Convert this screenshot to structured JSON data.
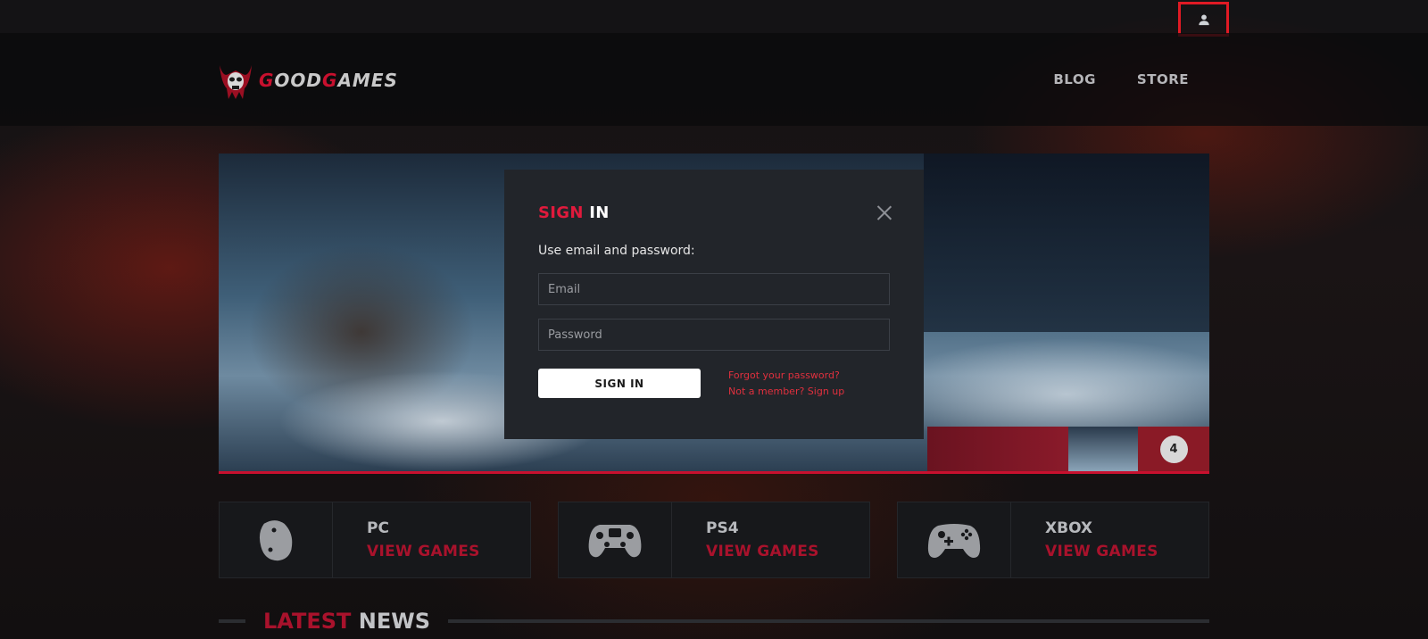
{
  "site": {
    "logo_part1": "G",
    "logo_part2": "OOD",
    "logo_part3": "G",
    "logo_part4": "AMES"
  },
  "topbar": {
    "user_icon": "user-icon"
  },
  "nav": {
    "items": [
      {
        "label": "BLOG"
      },
      {
        "label": "STORE"
      }
    ]
  },
  "slider": {
    "thumb_count": "4"
  },
  "modal": {
    "title_part1": "SIGN",
    "title_part2": "IN",
    "subtitle": "Use email and password:",
    "email_placeholder": "Email",
    "password_placeholder": "Password",
    "submit_label": "SIGN IN",
    "forgot_link": "Forgot your password?",
    "signup_link": "Not a member? Sign up",
    "close_icon": "close-icon"
  },
  "platforms": [
    {
      "name": "PC",
      "link": "VIEW GAMES",
      "icon": "mouse-icon"
    },
    {
      "name": "PS4",
      "link": "VIEW GAMES",
      "icon": "gamepad-icon"
    },
    {
      "name": "XBOX",
      "link": "VIEW GAMES",
      "icon": "xbox-controller-icon"
    }
  ],
  "news": {
    "title_part1": "LATEST",
    "title_part2": "NEWS"
  },
  "colors": {
    "accent": "#c8102e",
    "modal_bg": "#22252a",
    "card_bg": "#17181b"
  }
}
